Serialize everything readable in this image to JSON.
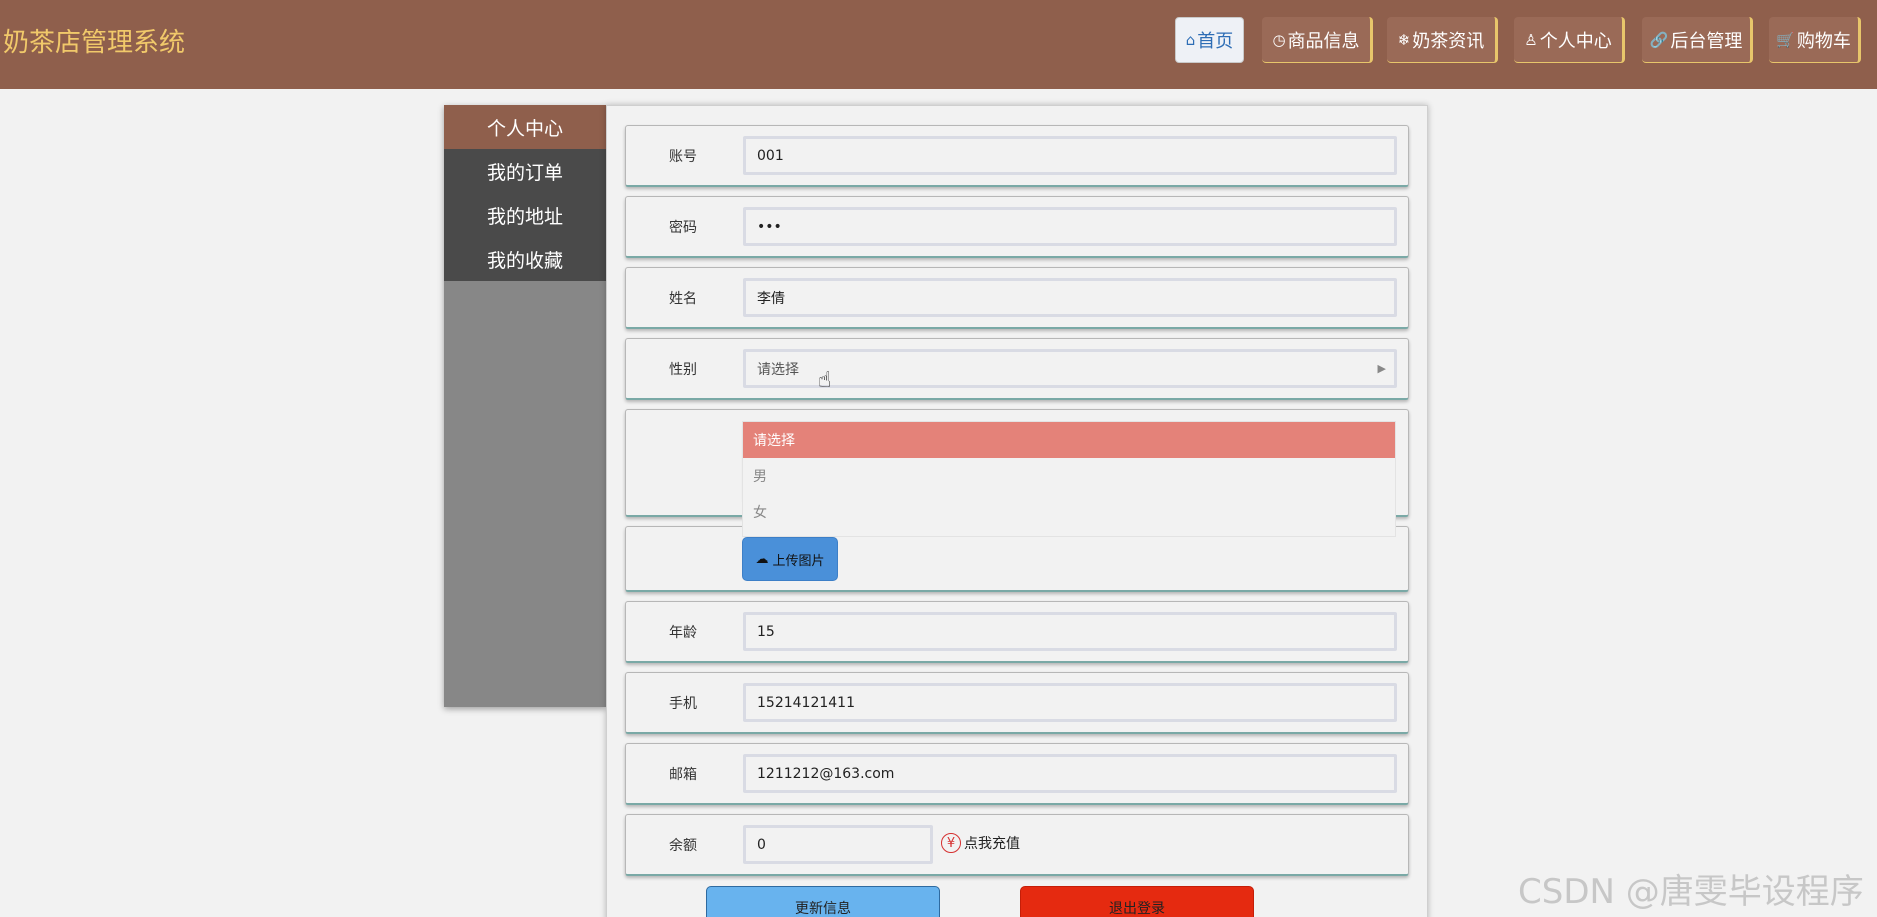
{
  "header": {
    "brand": "奶茶店管理系统",
    "nav": [
      {
        "icon": "home-icon",
        "glyph": "⌂",
        "label": "首页",
        "active": true
      },
      {
        "icon": "clock-icon",
        "glyph": "◷",
        "label": "商品信息",
        "active": false
      },
      {
        "icon": "snowflake-icon",
        "glyph": "❄",
        "label": "奶茶资讯",
        "active": false
      },
      {
        "icon": "user-icon",
        "glyph": "♙",
        "label": "个人中心",
        "active": false
      },
      {
        "icon": "link-icon",
        "glyph": "🔗",
        "label": "后台管理",
        "active": false
      },
      {
        "icon": "cart-icon",
        "glyph": "🛒",
        "label": "购物车",
        "active": false
      }
    ]
  },
  "sidebar": {
    "items": [
      {
        "label": "个人中心",
        "active": true
      },
      {
        "label": "我的订单",
        "active": false
      },
      {
        "label": "我的地址",
        "active": false
      },
      {
        "label": "我的收藏",
        "active": false
      }
    ]
  },
  "form": {
    "account": {
      "label": "账号",
      "value": "001"
    },
    "password": {
      "label": "密码",
      "value": "•••"
    },
    "name": {
      "label": "姓名",
      "value": "李倩"
    },
    "gender": {
      "label": "性别",
      "placeholder": "请选择",
      "options": [
        "请选择",
        "男",
        "女"
      ]
    },
    "upload_label": "上传图片",
    "age": {
      "label": "年龄",
      "value": "15"
    },
    "phone": {
      "label": "手机",
      "value": "15214121411"
    },
    "email": {
      "label": "邮箱",
      "value": "1211212@163.com"
    },
    "balance": {
      "label": "余额",
      "value": "0",
      "recharge": "点我充值",
      "recharge_icon": "¥"
    }
  },
  "actions": {
    "update": "更新信息",
    "logout": "退出登录"
  },
  "watermark": "CSDN @唐雯毕设程序"
}
